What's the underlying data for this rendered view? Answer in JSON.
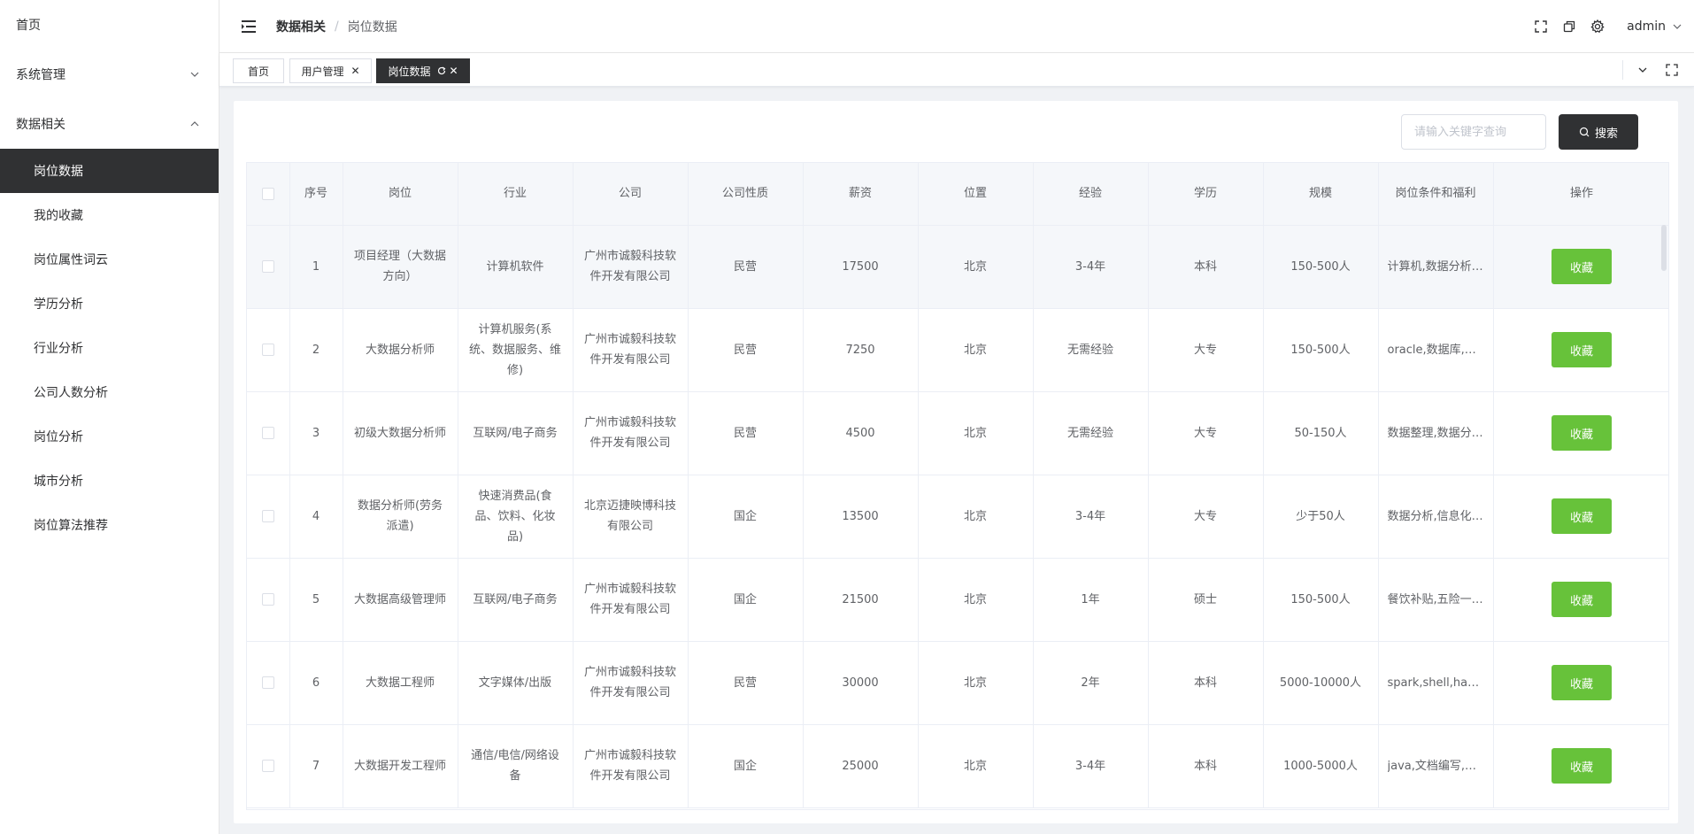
{
  "sidebar": {
    "home": "首页",
    "groups": [
      {
        "label": "系统管理",
        "expanded": false
      },
      {
        "label": "数据相关",
        "expanded": true
      }
    ],
    "items": [
      "岗位数据",
      "我的收藏",
      "岗位属性词云",
      "学历分析",
      "行业分析",
      "公司人数分析",
      "岗位分析",
      "城市分析",
      "岗位算法推荐"
    ],
    "active": "岗位数据"
  },
  "header": {
    "breadcrumb_parent": "数据相关",
    "breadcrumb_sep": "/",
    "breadcrumb_current": "岗位数据",
    "user": "admin"
  },
  "tabs": [
    {
      "label": "首页",
      "closable": false,
      "active": false
    },
    {
      "label": "用户管理",
      "closable": true,
      "active": false
    },
    {
      "label": "岗位数据",
      "closable": true,
      "active": true
    }
  ],
  "search": {
    "placeholder": "请输入关键字查询",
    "button_label": "搜索"
  },
  "table": {
    "headers": [
      "序号",
      "岗位",
      "行业",
      "公司",
      "公司性质",
      "薪资",
      "位置",
      "经验",
      "学历",
      "规模",
      "岗位条件和福利",
      "操作"
    ],
    "rows": [
      {
        "index": "1",
        "position": "项目经理（大数据方向）",
        "industry": "计算机软件",
        "company": "广州市诚毅科技软件开发有限公司",
        "nature": "民营",
        "salary": "17500",
        "location": "北京",
        "experience": "3-4年",
        "education": "本科",
        "scale": "150-500人",
        "benefits": "计算机,数据分析,项目管理",
        "action": "收藏"
      },
      {
        "index": "2",
        "position": "大数据分析师",
        "industry": "计算机服务(系统、数据服务、维修)",
        "company": "广州市诚毅科技软件开发有限公司",
        "nature": "民营",
        "salary": "7250",
        "location": "北京",
        "experience": "无需经验",
        "education": "大专",
        "scale": "150-500人",
        "benefits": "oracle,数据库,大数据",
        "action": "收藏"
      },
      {
        "index": "3",
        "position": "初级大数据分析师",
        "industry": "互联网/电子商务",
        "company": "广州市诚毅科技软件开发有限公司",
        "nature": "民营",
        "salary": "4500",
        "location": "北京",
        "experience": "无需经验",
        "education": "大专",
        "scale": "50-150人",
        "benefits": "数据整理,数据分析,报表",
        "action": "收藏"
      },
      {
        "index": "4",
        "position": "数据分析师(劳务派遣)",
        "industry": "快速消费品(食品、饮料、化妆品)",
        "company": "北京迈捷映博科技有限公司",
        "nature": "国企",
        "salary": "13500",
        "location": "北京",
        "experience": "3-4年",
        "education": "大专",
        "scale": "少于50人",
        "benefits": "数据分析,信息化,报表",
        "action": "收藏"
      },
      {
        "index": "5",
        "position": "大数据高级管理师",
        "industry": "互联网/电子商务",
        "company": "广州市诚毅科技软件开发有限公司",
        "nature": "国企",
        "salary": "21500",
        "location": "北京",
        "experience": "1年",
        "education": "硕士",
        "scale": "150-500人",
        "benefits": "餐饮补贴,五险一金,年终奖",
        "action": "收藏"
      },
      {
        "index": "6",
        "position": "大数据工程师",
        "industry": "文字媒体/出版",
        "company": "广州市诚毅科技软件开发有限公司",
        "nature": "民营",
        "salary": "30000",
        "location": "北京",
        "experience": "2年",
        "education": "本科",
        "scale": "5000-10000人",
        "benefits": "spark,shell,hadoop",
        "action": "收藏"
      },
      {
        "index": "7",
        "position": "大数据开发工程师",
        "industry": "通信/电信/网络设备",
        "company": "广州市诚毅科技软件开发有限公司",
        "nature": "国企",
        "salary": "25000",
        "location": "北京",
        "experience": "3-4年",
        "education": "本科",
        "scale": "1000-5000人",
        "benefits": "java,文档编写,大数据",
        "action": "收藏"
      }
    ]
  },
  "colors": {
    "sidebar_active_bg": "#303133",
    "favorite_button": "#67c23a",
    "search_button": "#303133"
  }
}
